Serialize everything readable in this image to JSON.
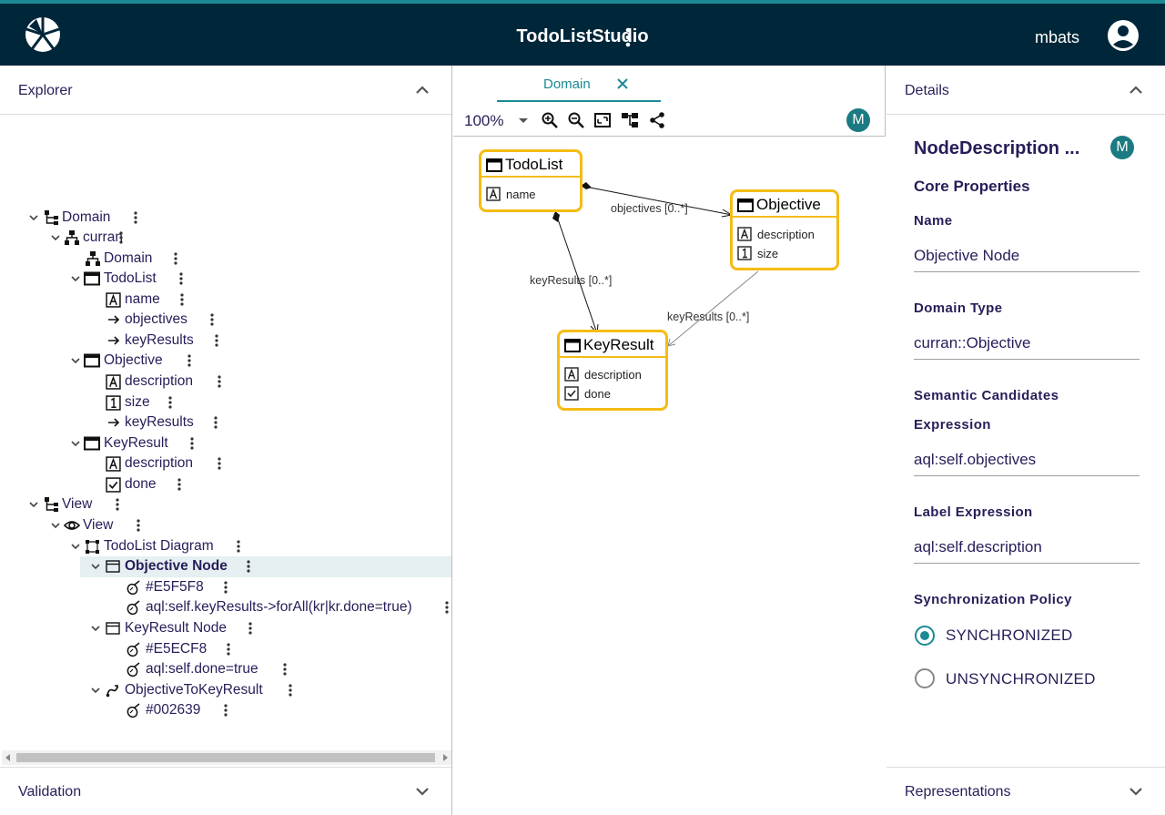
{
  "header": {
    "title": "TodoListStudio",
    "username": "mbats",
    "logo_icon": "sirius-logo-icon",
    "menu_icon": "more-vert-icon",
    "account_icon": "account-circle-icon"
  },
  "explorer": {
    "title": "Explorer",
    "tree": [
      {
        "label": "Domain",
        "icon": "domain-tree-icon",
        "expanded": true
      },
      {
        "label": "curran",
        "icon": "entity-hierarchy-icon",
        "expanded": true
      },
      {
        "label": "Domain",
        "icon": "entity-hierarchy-icon"
      },
      {
        "label": "TodoList",
        "icon": "class-icon",
        "expanded": true
      },
      {
        "label": "name",
        "icon": "string-attribute-icon"
      },
      {
        "label": "objectives",
        "icon": "reference-arrow-icon"
      },
      {
        "label": "keyResults",
        "icon": "reference-arrow-icon"
      },
      {
        "label": "Objective",
        "icon": "class-icon",
        "expanded": true
      },
      {
        "label": "description",
        "icon": "string-attribute-icon"
      },
      {
        "label": "size",
        "icon": "number-attribute-icon"
      },
      {
        "label": "keyResults",
        "icon": "reference-arrow-icon"
      },
      {
        "label": "KeyResult",
        "icon": "class-icon",
        "expanded": true
      },
      {
        "label": "description",
        "icon": "string-attribute-icon"
      },
      {
        "label": "done",
        "icon": "boolean-attribute-icon"
      },
      {
        "label": "View",
        "icon": "domain-tree-icon",
        "expanded": true
      },
      {
        "label": "View",
        "icon": "eye-icon",
        "expanded": true
      },
      {
        "label": "TodoList Diagram",
        "icon": "diagram-icon",
        "expanded": true
      },
      {
        "label": "Objective Node",
        "icon": "node-icon",
        "expanded": true,
        "selected": true
      },
      {
        "label": "#E5F5F8",
        "icon": "style-icon"
      },
      {
        "label": "aql:self.keyResults->forAll(kr|kr.done=true)",
        "icon": "style-icon"
      },
      {
        "label": "KeyResult Node",
        "icon": "node-icon",
        "expanded": true
      },
      {
        "label": "#E5ECF8",
        "icon": "style-icon"
      },
      {
        "label": "aql:self.done=true",
        "icon": "style-icon"
      },
      {
        "label": "ObjectiveToKeyResult",
        "icon": "edge-icon",
        "expanded": true
      },
      {
        "label": "#002639",
        "icon": "style-icon"
      }
    ]
  },
  "validation": {
    "title": "Validation"
  },
  "editor": {
    "tab_label": "Domain",
    "zoom": "100%",
    "avatar": "M",
    "nodes": [
      {
        "title": "TodoList",
        "attributes": [
          {
            "icon": "string-attribute-icon",
            "label": "name"
          }
        ]
      },
      {
        "title": "Objective",
        "attributes": [
          {
            "icon": "string-attribute-icon",
            "label": "description"
          },
          {
            "icon": "number-attribute-icon",
            "label": "size"
          }
        ]
      },
      {
        "title": "KeyResult",
        "attributes": [
          {
            "icon": "string-attribute-icon",
            "label": "description"
          },
          {
            "icon": "boolean-attribute-icon",
            "label": "done"
          }
        ]
      }
    ],
    "edges": [
      {
        "label": "objectives [0..*]"
      },
      {
        "label": "keyResults [0..*]"
      },
      {
        "label": "keyResults [0..*]"
      }
    ]
  },
  "details": {
    "title": "Details",
    "element_title": "NodeDescription ...",
    "avatar": "M",
    "section": "Core Properties",
    "name_label": "Name",
    "name_value": "Objective Node",
    "domain_type_label": "Domain Type",
    "domain_type_value": "curran::Objective",
    "semantic_label": "Semantic Candidates",
    "expression_label": "Expression",
    "expression_value": "aql:self.objectives",
    "label_expr_label": "Label Expression",
    "label_expr_value": "aql:self.description",
    "sync_label": "Synchronization Policy",
    "sync_options": [
      "SYNCHRONIZED",
      "UNSYNCHRONIZED"
    ],
    "sync_selected": "SYNCHRONIZED"
  },
  "representations": {
    "title": "Representations"
  },
  "colors": {
    "header_bg": "#002639",
    "accent": "#1b8a94",
    "node_border": "#f5bc15",
    "selection": "#e6eff1"
  }
}
